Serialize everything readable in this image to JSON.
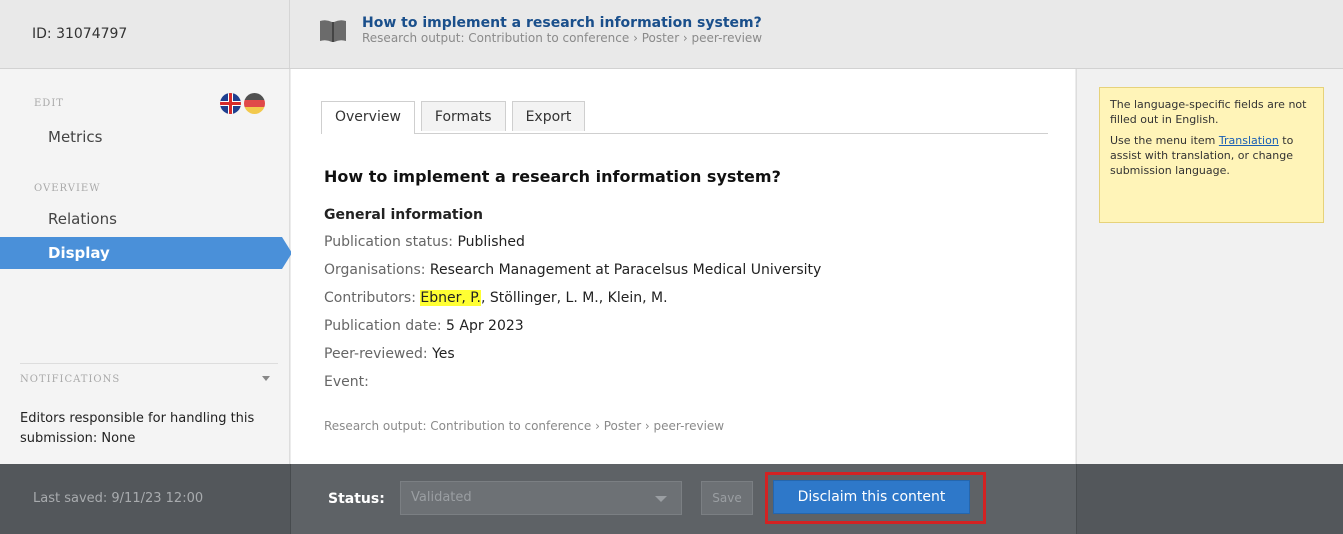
{
  "header": {
    "id_label": "ID: 31074797",
    "title": "How to implement a research information system?",
    "subtitle": "Research output: Contribution to conference › Poster › peer-review"
  },
  "sidebar": {
    "edit_heading": "EDIT",
    "overview_heading": "OVERVIEW",
    "items": [
      {
        "label": "Metrics"
      },
      {
        "label": "Relations"
      },
      {
        "label": "Display"
      }
    ],
    "active_item": "Display",
    "language_flags": [
      "uk-flag-icon",
      "de-flag-icon"
    ],
    "notifications_heading": "NOTIFICATIONS",
    "notifications_text": "Editors responsible for handling this submission: None"
  },
  "tabs": [
    {
      "label": "Overview"
    },
    {
      "label": "Formats"
    },
    {
      "label": "Export"
    }
  ],
  "active_tab": "Overview",
  "content": {
    "title": "How to implement a research information system?",
    "general_heading": "General information",
    "publication_status_label": "Publication status: ",
    "publication_status": "Published",
    "organisations_label": "Organisations: ",
    "organisations": "Research Management at Paracelsus Medical University",
    "contributors_label": "Contributors: ",
    "contributor_highlighted": "Ebner, P.",
    "contributors_rest": ", Stöllinger, L. M., Klein, M.",
    "publication_date_label": "Publication date: ",
    "publication_date": "5 Apr 2023",
    "peer_reviewed_label": "Peer-reviewed: ",
    "peer_reviewed": "Yes",
    "event_label": "Event:",
    "footnote": "Research output: Contribution to conference › Poster › peer-review"
  },
  "notice": {
    "line1": "The language-specific fields are not filled out in English.",
    "line2_prefix": "Use the menu item ",
    "line2_link": "Translation",
    "line2_suffix": " to assist with translation, or change submission language."
  },
  "footer": {
    "last_saved": "Last saved: 9/11/23 12:00",
    "status_label": "Status:",
    "status_value": "Validated",
    "save_label": "Save",
    "disclaim_label": "Disclaim this content"
  },
  "colors": {
    "accent": "#4a90d9",
    "primary_button": "#2e78c9",
    "highlight": "#ffff33",
    "notice_bg": "#fff4b8",
    "callout_frame": "#d42222"
  }
}
